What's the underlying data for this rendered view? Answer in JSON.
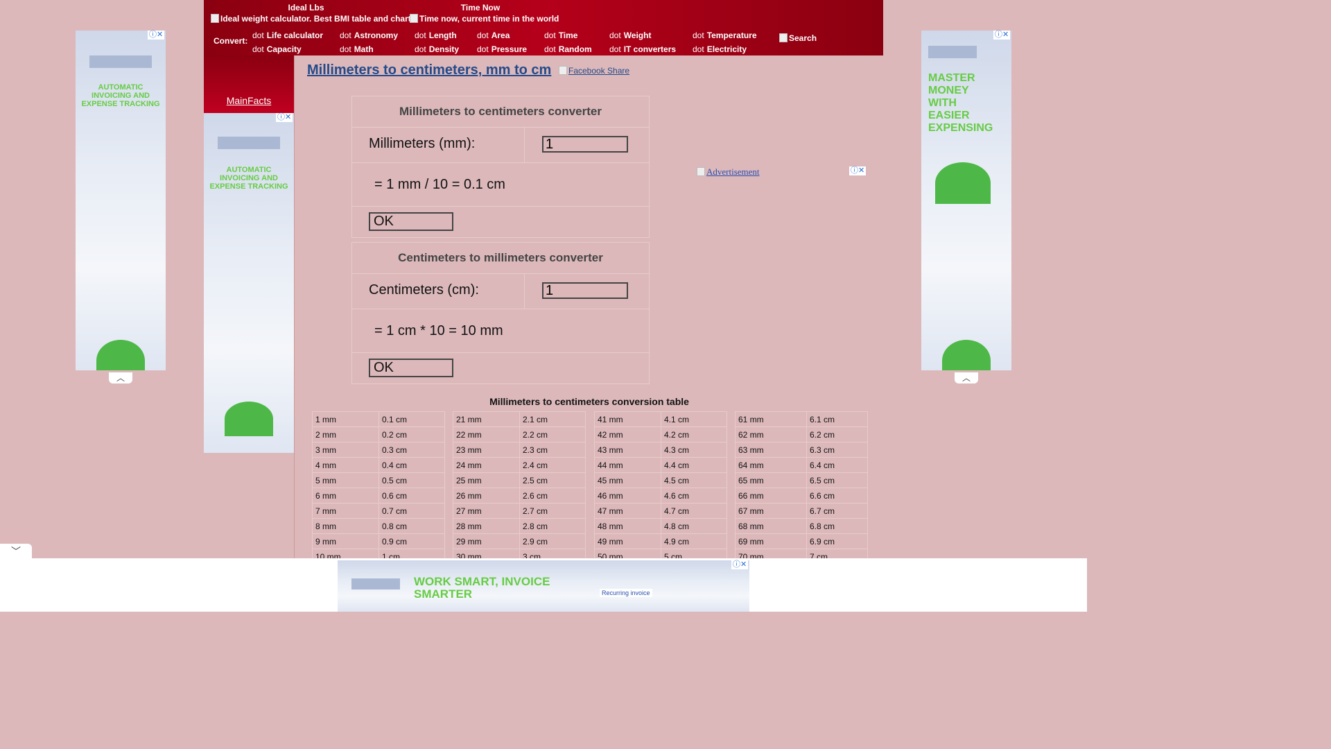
{
  "header": {
    "ideal_lbs": {
      "label": "Ideal Lbs",
      "img_alt": "Ideal weight calculator. Best BMI table and chart"
    },
    "time_now": {
      "label": "Time Now",
      "img_alt": "Time now, current time in the world"
    },
    "convert_label": "Convert:",
    "dot_alt": "dot",
    "nav": [
      "Life calculator",
      "Astronomy",
      "Length",
      "Area",
      "Time",
      "Weight",
      "Temperature",
      "Capacity",
      "Math",
      "Density",
      "Pressure",
      "Random",
      "IT converters",
      "Electricity"
    ],
    "search_alt": "Search"
  },
  "sidebar": {
    "mainfacts": "MainFacts"
  },
  "ads": {
    "left_text": "AUTOMATIC INVOICING AND EXPENSE TRACKING",
    "right_text": "MASTER MONEY WITH EASIER EXPENSING",
    "right_inline": "Advertisement",
    "bottom_text": "WORK SMART, INVOICE SMARTER",
    "bottom_badge": "Recurring invoice",
    "close_glyph": "ⓘ✕"
  },
  "page": {
    "title": "Millimeters to centimeters, mm to cm",
    "facebook_alt": "Facebook",
    "share": "Share"
  },
  "converter1": {
    "title": "Millimeters to centimeters converter",
    "label": "Millimeters (mm):",
    "value": "1",
    "result": "= 1 mm / 10 = 0.1 cm",
    "ok": "OK"
  },
  "converter2": {
    "title": "Centimeters to millimeters converter",
    "label": "Centimeters (cm):",
    "value": "1",
    "result": "= 1 cm * 10 = 10 mm",
    "ok": "OK"
  },
  "table": {
    "title": "Millimeters to centimeters conversion table",
    "groups": [
      [
        [
          "1 mm",
          "0.1 cm"
        ],
        [
          "2 mm",
          "0.2 cm"
        ],
        [
          "3 mm",
          "0.3 cm"
        ],
        [
          "4 mm",
          "0.4 cm"
        ],
        [
          "5 mm",
          "0.5 cm"
        ],
        [
          "6 mm",
          "0.6 cm"
        ],
        [
          "7 mm",
          "0.7 cm"
        ],
        [
          "8 mm",
          "0.8 cm"
        ],
        [
          "9 mm",
          "0.9 cm"
        ],
        [
          "10 mm",
          "1 cm"
        ]
      ],
      [
        [
          "21 mm",
          "2.1 cm"
        ],
        [
          "22 mm",
          "2.2 cm"
        ],
        [
          "23 mm",
          "2.3 cm"
        ],
        [
          "24 mm",
          "2.4 cm"
        ],
        [
          "25 mm",
          "2.5 cm"
        ],
        [
          "26 mm",
          "2.6 cm"
        ],
        [
          "27 mm",
          "2.7 cm"
        ],
        [
          "28 mm",
          "2.8 cm"
        ],
        [
          "29 mm",
          "2.9 cm"
        ],
        [
          "30 mm",
          "3 cm"
        ]
      ],
      [
        [
          "41 mm",
          "4.1 cm"
        ],
        [
          "42 mm",
          "4.2 cm"
        ],
        [
          "43 mm",
          "4.3 cm"
        ],
        [
          "44 mm",
          "4.4 cm"
        ],
        [
          "45 mm",
          "4.5 cm"
        ],
        [
          "46 mm",
          "4.6 cm"
        ],
        [
          "47 mm",
          "4.7 cm"
        ],
        [
          "48 mm",
          "4.8 cm"
        ],
        [
          "49 mm",
          "4.9 cm"
        ],
        [
          "50 mm",
          "5 cm"
        ]
      ],
      [
        [
          "61 mm",
          "6.1 cm"
        ],
        [
          "62 mm",
          "6.2 cm"
        ],
        [
          "63 mm",
          "6.3 cm"
        ],
        [
          "64 mm",
          "6.4 cm"
        ],
        [
          "65 mm",
          "6.5 cm"
        ],
        [
          "66 mm",
          "6.6 cm"
        ],
        [
          "67 mm",
          "6.7 cm"
        ],
        [
          "68 mm",
          "6.8 cm"
        ],
        [
          "69 mm",
          "6.9 cm"
        ],
        [
          "70 mm",
          "7 cm"
        ]
      ]
    ]
  }
}
